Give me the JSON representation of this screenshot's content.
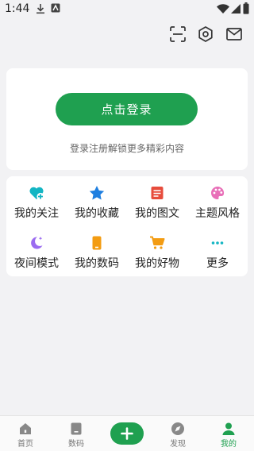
{
  "status_bar": {
    "time": "1:44"
  },
  "top_actions": [
    {
      "icon": "scan-icon"
    },
    {
      "icon": "settings-icon"
    },
    {
      "icon": "mail-icon"
    }
  ],
  "login": {
    "button_label": "点击登录",
    "hint": "登录注册解锁更多精彩内容"
  },
  "menu": {
    "items": [
      {
        "label": "我的关注",
        "icon": "heart-plus-icon",
        "color": "#13b5c3"
      },
      {
        "label": "我的收藏",
        "icon": "star-icon",
        "color": "#1f7fe0"
      },
      {
        "label": "我的图文",
        "icon": "article-icon",
        "color": "#e74c3c"
      },
      {
        "label": "主题风格",
        "icon": "palette-icon",
        "color": "#e86fb8"
      },
      {
        "label": "夜间模式",
        "icon": "moon-icon",
        "color": "#9b6cf0"
      },
      {
        "label": "我的数码",
        "icon": "phone-icon",
        "color": "#f39c12"
      },
      {
        "label": "我的好物",
        "icon": "cart-icon",
        "color": "#f39c12"
      },
      {
        "label": "更多",
        "icon": "more-icon",
        "color": "#13b5c3"
      }
    ]
  },
  "bottom_nav": {
    "items": [
      {
        "label": "首页",
        "icon": "home-icon"
      },
      {
        "label": "数码",
        "icon": "device-icon"
      },
      {
        "label": "",
        "icon": "add-icon"
      },
      {
        "label": "发现",
        "icon": "compass-icon"
      },
      {
        "label": "我的",
        "icon": "person-icon",
        "active": true
      }
    ]
  },
  "colors": {
    "accent": "#1fa050",
    "background": "#f2f2f4"
  }
}
